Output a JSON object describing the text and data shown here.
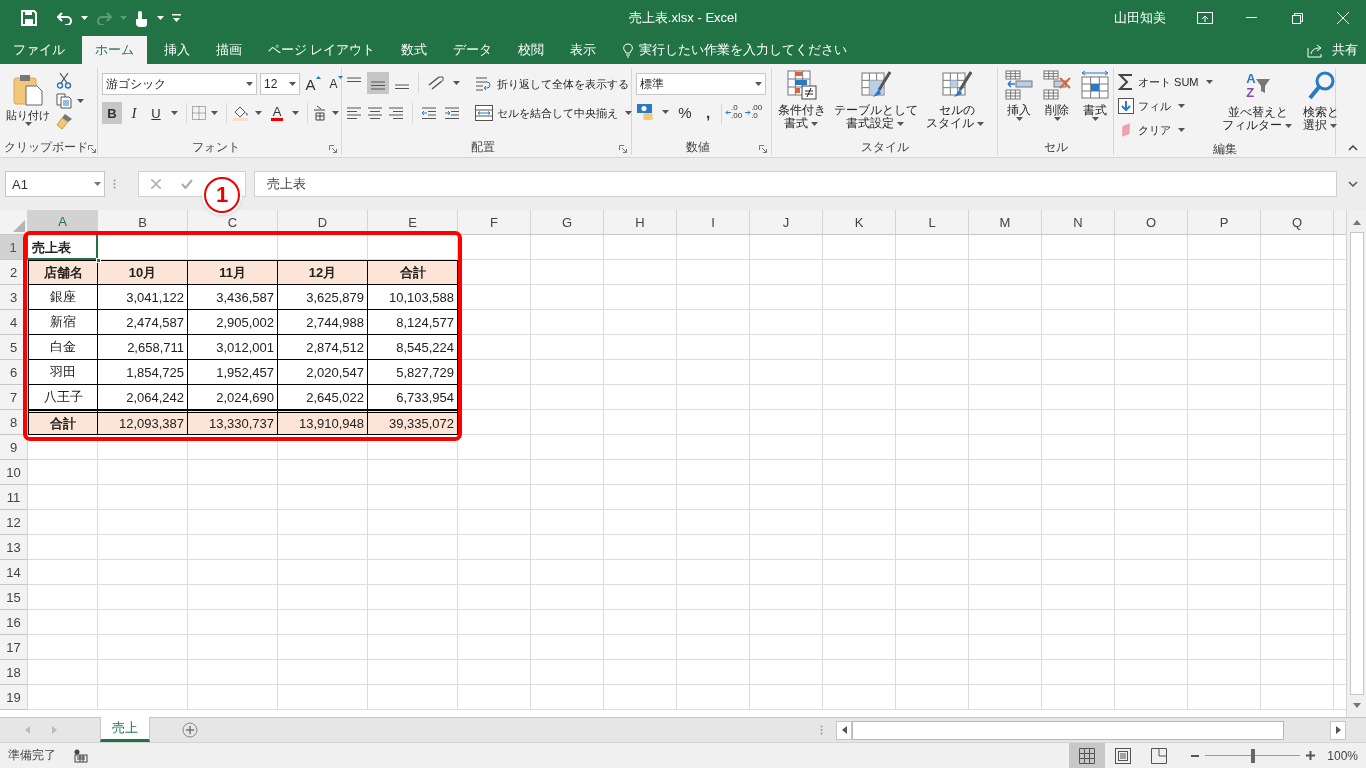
{
  "window": {
    "title": "売上表.xlsx - Excel",
    "user": "山田知美"
  },
  "tabs": [
    {
      "label": "ファイル",
      "selected": false
    },
    {
      "label": "ホーム",
      "selected": true
    },
    {
      "label": "挿入",
      "selected": false
    },
    {
      "label": "描画",
      "selected": false
    },
    {
      "label": "ページ レイアウト",
      "selected": false
    },
    {
      "label": "数式",
      "selected": false
    },
    {
      "label": "データ",
      "selected": false
    },
    {
      "label": "校閲",
      "selected": false
    },
    {
      "label": "表示",
      "selected": false
    }
  ],
  "tell_me": {
    "placeholder": "実行したい作業を入力してください"
  },
  "share": "共有",
  "ribbon": {
    "groups": [
      {
        "kind": "clipboard",
        "label": "クリップボード",
        "paste": "貼り付け"
      },
      {
        "kind": "font",
        "label": "フォント",
        "font_name": "游ゴシック",
        "font_size": "12",
        "grow": "A",
        "shrink": "A",
        "bold": {
          "label": "B",
          "on": true
        },
        "italic": {
          "label": "I",
          "on": false
        },
        "underline": {
          "label": "U",
          "on": false
        },
        "font_color": "A"
      },
      {
        "kind": "alignment",
        "label": "配置",
        "align_middle_on": true,
        "wrap_text": "折り返して全体を表示する",
        "merge": "セルを結合して中央揃え"
      },
      {
        "kind": "number",
        "label": "数値",
        "format": "標準",
        "percent": "%",
        "comma": ",",
        "decimals": [
          {
            "top": ".0",
            "bottom": ".00"
          },
          {
            "top": ".00",
            "bottom": ".0"
          }
        ]
      },
      {
        "kind": "styles",
        "label": "スタイル",
        "buttons": [
          {
            "lines": [
              "条件付き",
              "書式"
            ]
          },
          {
            "lines": [
              "テーブルとして",
              "書式設定"
            ]
          },
          {
            "lines": [
              "セルの",
              "スタイル"
            ]
          }
        ]
      },
      {
        "kind": "cells",
        "label": "セル",
        "buttons": [
          {
            "lines": [
              "挿入"
            ]
          },
          {
            "lines": [
              "削除"
            ]
          },
          {
            "lines": [
              "書式"
            ]
          }
        ]
      },
      {
        "kind": "editing",
        "label": "編集",
        "small": [
          "オート SUM",
          "フィル",
          "クリア"
        ],
        "sort_letters": [
          "A",
          "Z"
        ],
        "buttons": [
          {
            "lines": [
              "並べ替えと",
              "フィルター"
            ]
          },
          {
            "lines": [
              "検索と",
              "選択"
            ]
          }
        ]
      }
    ]
  },
  "formula_bar": {
    "name_box": "A1",
    "content": "売上表"
  },
  "callout": "1",
  "columns": [
    {
      "label": "A",
      "selected": true
    },
    {
      "label": "B",
      "selected": false
    },
    {
      "label": "C",
      "selected": false
    },
    {
      "label": "D",
      "selected": false
    },
    {
      "label": "E",
      "selected": false
    },
    {
      "label": "F",
      "selected": false
    },
    {
      "label": "G",
      "selected": false
    },
    {
      "label": "H",
      "selected": false
    },
    {
      "label": "I",
      "selected": false
    },
    {
      "label": "J",
      "selected": false
    },
    {
      "label": "K",
      "selected": false
    },
    {
      "label": "L",
      "selected": false
    },
    {
      "label": "M",
      "selected": false
    },
    {
      "label": "N",
      "selected": false
    },
    {
      "label": "O",
      "selected": false
    },
    {
      "label": "P",
      "selected": false
    },
    {
      "label": "Q",
      "selected": false
    }
  ],
  "rows": [
    {
      "number": "1",
      "selected": true,
      "kind": "title",
      "cells": [
        "売上表"
      ]
    },
    {
      "number": "2",
      "selected": false,
      "kind": "header",
      "cells": [
        "店舗名",
        "10月",
        "11月",
        "12月",
        "合計"
      ]
    },
    {
      "number": "3",
      "selected": false,
      "kind": "data",
      "cells": [
        "銀座",
        "3,041,122",
        "3,436,587",
        "3,625,879",
        "10,103,588"
      ]
    },
    {
      "number": "4",
      "selected": false,
      "kind": "data",
      "cells": [
        "新宿",
        "2,474,587",
        "2,905,002",
        "2,744,988",
        "8,124,577"
      ]
    },
    {
      "number": "5",
      "selected": false,
      "kind": "data",
      "cells": [
        "白金",
        "2,658,711",
        "3,012,001",
        "2,874,512",
        "8,545,224"
      ]
    },
    {
      "number": "6",
      "selected": false,
      "kind": "data",
      "cells": [
        "羽田",
        "1,854,725",
        "1,952,457",
        "2,020,547",
        "5,827,729"
      ]
    },
    {
      "number": "7",
      "selected": false,
      "kind": "data",
      "cells": [
        "八王子",
        "2,064,242",
        "2,024,690",
        "2,645,022",
        "6,733,954"
      ]
    },
    {
      "number": "8",
      "selected": false,
      "kind": "total",
      "cells": [
        "合計",
        "12,093,387",
        "13,330,737",
        "13,910,948",
        "39,335,072"
      ]
    },
    {
      "number": "9",
      "selected": false
    },
    {
      "number": "10",
      "selected": false
    },
    {
      "number": "11",
      "selected": false
    },
    {
      "number": "12",
      "selected": false
    },
    {
      "number": "13",
      "selected": false
    },
    {
      "number": "14",
      "selected": false
    },
    {
      "number": "15",
      "selected": false
    },
    {
      "number": "16",
      "selected": false
    },
    {
      "number": "17",
      "selected": false
    },
    {
      "number": "18",
      "selected": false
    },
    {
      "number": "19",
      "selected": false
    }
  ],
  "sheet_tabs": [
    {
      "label": "売上",
      "selected": true
    }
  ],
  "status_bar": {
    "status": "準備完了",
    "views": [
      {
        "selected": true
      },
      {
        "selected": false
      },
      {
        "selected": false
      }
    ],
    "zoom": {
      "level": 0.5,
      "reading": "100%"
    }
  }
}
